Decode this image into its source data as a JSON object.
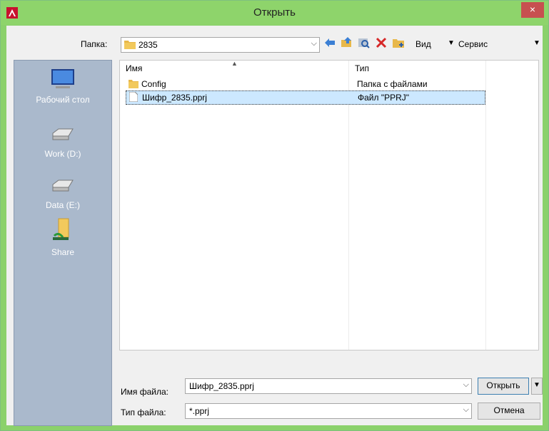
{
  "window": {
    "title": "Открыть",
    "close_glyph": "×",
    "accent": "#8ed46b"
  },
  "toolbar": {
    "folder_label": "Папка:",
    "folder_value": "2835",
    "view_label": "Вид",
    "service_label": "Сервис"
  },
  "places": [
    {
      "label": "Рабочий стол",
      "icon": "desktop-icon"
    },
    {
      "label": "Work (D:)",
      "icon": "drive-icon"
    },
    {
      "label": "Data (E:)",
      "icon": "drive-icon"
    },
    {
      "label": "Share",
      "icon": "shared-folder-icon"
    }
  ],
  "list": {
    "columns": [
      "Имя",
      "Тип"
    ],
    "rows": [
      {
        "name": "Config",
        "type": "Папка с файлами",
        "icon": "folder-icon",
        "selected": false
      },
      {
        "name": "Шифр_2835.pprj",
        "type": "Файл \"PPRJ\"",
        "icon": "file-icon",
        "selected": true
      }
    ]
  },
  "filename": {
    "label": "Имя файла:",
    "value": "Шифр_2835.pprj"
  },
  "filetype": {
    "label": "Тип файла:",
    "value": "*.pprj"
  },
  "buttons": {
    "open": "Открыть",
    "cancel": "Отмена"
  }
}
